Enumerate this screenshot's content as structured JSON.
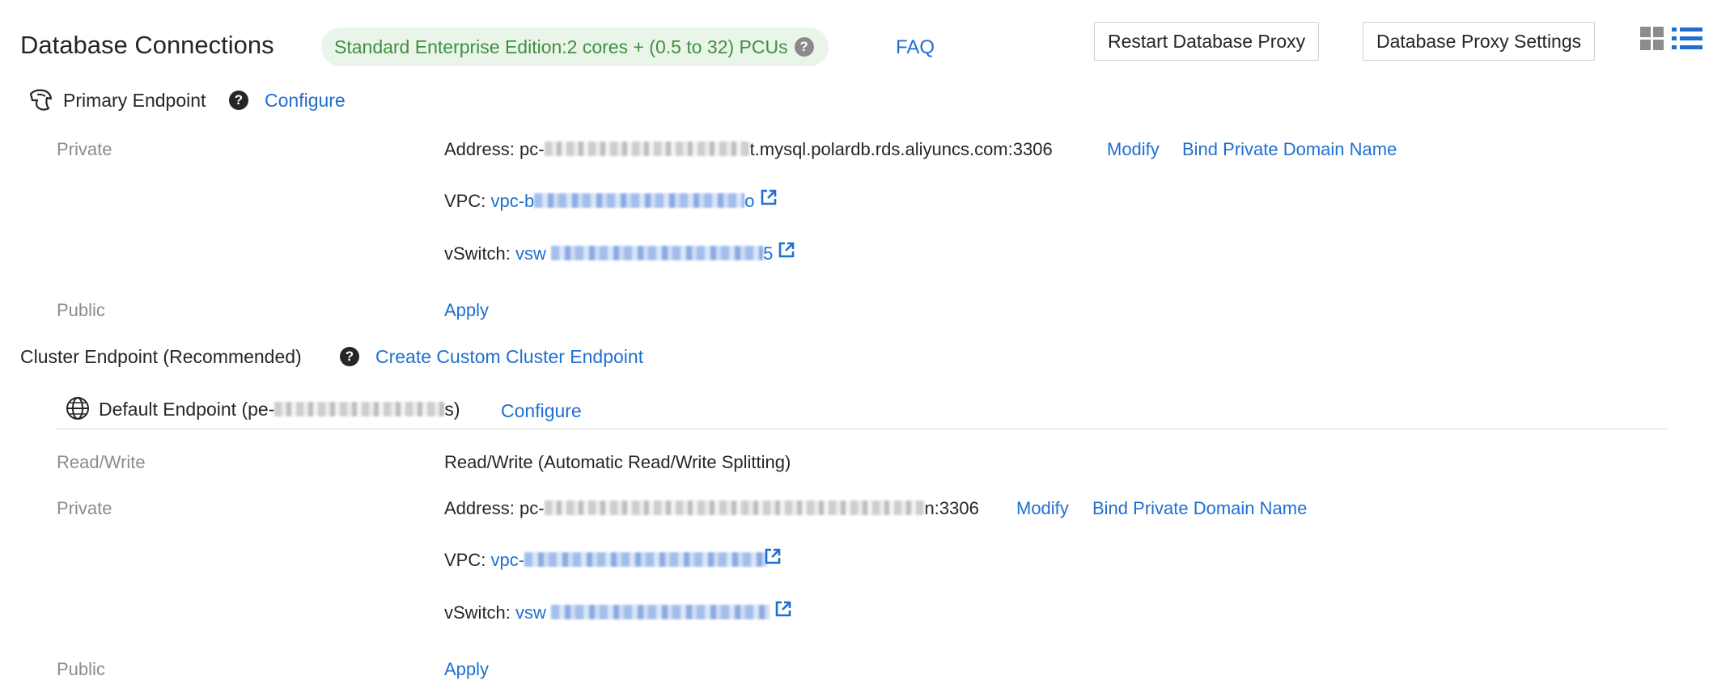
{
  "header": {
    "title": "Database Connections",
    "edition_badge": "Standard Enterprise Edition:2 cores + (0.5 to 32) PCUs",
    "faq_link": "FAQ",
    "restart_button": "Restart Database Proxy",
    "settings_button": "Database Proxy Settings",
    "view_icons": [
      "grid-view-icon",
      "list-view-icon"
    ]
  },
  "primary": {
    "title": "Primary Endpoint",
    "configure": "Configure",
    "private_label": "Private",
    "address_label": "Address:",
    "address_prefix": "pc-",
    "address_suffix": "t.mysql.polardb.rds.aliyuncs.com:3306",
    "modify": "Modify",
    "bind_domain": "Bind Private Domain Name",
    "vpc_label": "VPC:",
    "vpc_value": "vpc-b",
    "vpc_tail": "o",
    "vswitch_label": "vSwitch:",
    "vswitch_value": "vsw",
    "vswitch_tail": "5",
    "public_label": "Public",
    "apply": "Apply"
  },
  "cluster": {
    "title": "Cluster Endpoint (Recommended)",
    "create_link": "Create Custom Cluster Endpoint",
    "default_endpoint_prefix": "Default Endpoint (pe-",
    "default_endpoint_suffix": "s)",
    "configure": "Configure",
    "rw_label": "Read/Write",
    "rw_value": "Read/Write (Automatic Read/Write Splitting)",
    "private_label": "Private",
    "address_label": "Address:",
    "address_prefix": "pc-",
    "address_suffix": "n:3306",
    "modify": "Modify",
    "bind_domain": "Bind Private Domain Name",
    "vpc_label": "VPC:",
    "vpc_value": "vpc-",
    "vswitch_label": "vSwitch:",
    "vswitch_value": "vsw",
    "public_label": "Public",
    "apply": "Apply"
  },
  "colors": {
    "link": "#1f6fd1",
    "badge_bg": "#eaf5ea",
    "badge_text": "#3f8f3f",
    "muted_label": "#8c8c8c"
  }
}
